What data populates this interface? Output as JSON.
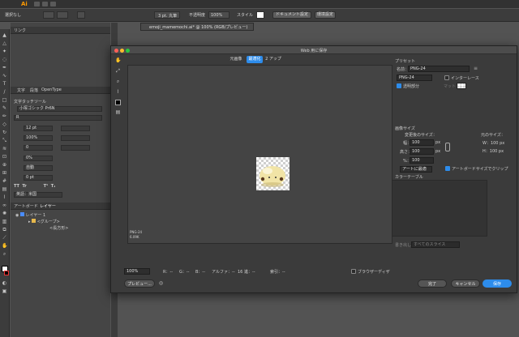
{
  "topbar": {
    "app_logo": "Ai"
  },
  "control_bar": {
    "selection_label": "選択なし",
    "stroke_weight": "3 pt. 丸筆",
    "opacity_label": "不透明度",
    "opacity_value": "100%",
    "style_label": "スタイル",
    "document_setup": "ドキュメント設定",
    "preferences": "環境設定"
  },
  "document_tab": {
    "title": "emoji_mamemochi.ai* @ 100% (RGB/プレビュー)"
  },
  "panels": {
    "link_tab": "リンク",
    "char_tabs": [
      "文字",
      "段落",
      "OpenType"
    ],
    "touch_type": "文字タッチツール",
    "font_family": "小塚ゴシック Pr6N",
    "font_style": "R",
    "font_size": "12 pt",
    "scale_h": "100%",
    "scale_v": "100%",
    "tracking": "0",
    "baseline": "0%",
    "kerning": "自動",
    "rotation": "0 pt",
    "language": "英語：米国",
    "artboard_tab": "アートボード",
    "layers_tab": "レイヤー",
    "layer_name": "レイヤー 1",
    "group_name": "<グループ>",
    "path_name": "<長方形>"
  },
  "dialog": {
    "title": "Web 用に保存",
    "view_tabs": [
      "元画像",
      "最適化",
      "2 アップ"
    ],
    "active_tab": "最適化",
    "preview_format": "PNG-24",
    "preview_size": "6.09K",
    "preset_label": "プリセット",
    "name_label": "名前：",
    "preset_name": "PNG-24",
    "format": "PNG-24",
    "interlace_label": "インターレース",
    "transparency_label": "透明部分",
    "matte_label": "マット：",
    "image_size_label": "画像サイズ",
    "new_size_label": "変更後のサイズ：",
    "original_size_label": "元のサイズ：",
    "width_label": "幅：",
    "width_value": "100",
    "height_label": "高さ：",
    "height_value": "100",
    "percent_label": "%：",
    "percent_value": "100",
    "px_unit": "px",
    "orig_w": "W：100 px",
    "orig_h": "H：100 px",
    "clip_mode": "アートに最適",
    "artboard_clip_label": "アートボードサイズでクリップ",
    "color_table_label": "カラーテーブル",
    "bottom_name": "書き出し",
    "bottom_name_placeholder": "すべてのスライス",
    "zoom": "100%",
    "r_label": "R：--",
    "g_label": "G：--",
    "b_label": "B：--",
    "alpha_label": "アルファ：--",
    "hex_label": "16 進：--",
    "index_label": "索引：--",
    "browser_dither": "ブラウザーディザ",
    "preview_button": "プレビュー...",
    "done_button": "完了",
    "cancel_button": "キャンセル",
    "save_button": "保存"
  }
}
